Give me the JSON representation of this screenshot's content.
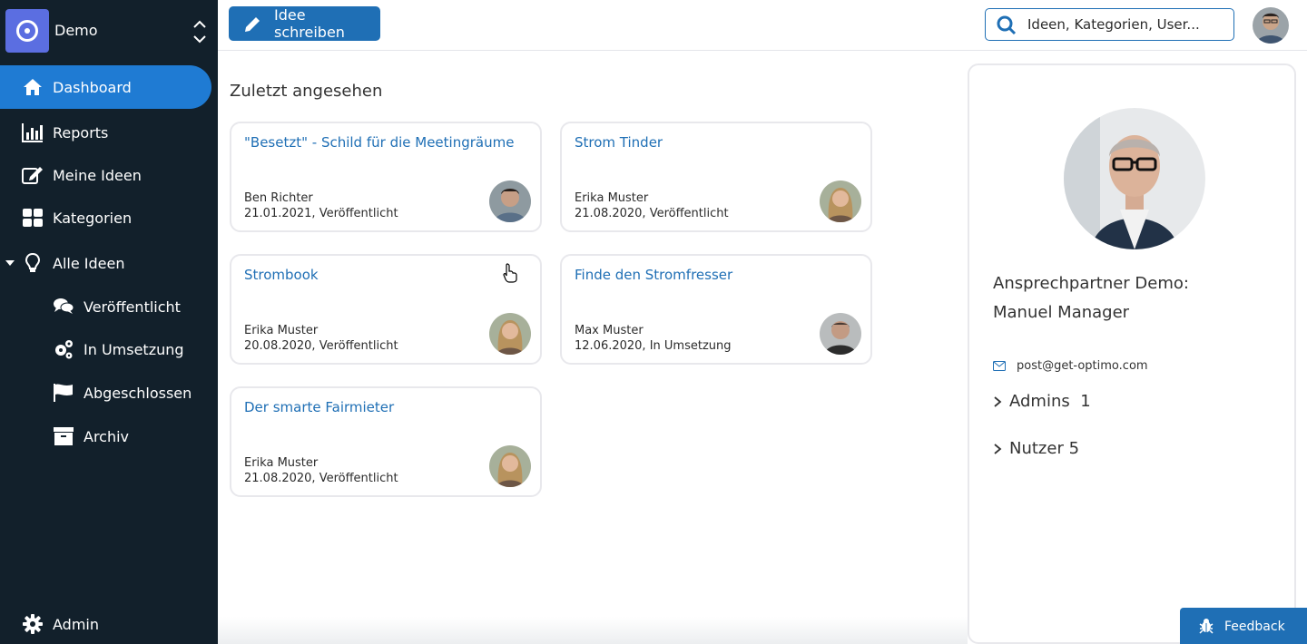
{
  "sidebar": {
    "org_name": "Demo",
    "items": [
      {
        "label": "Dashboard",
        "icon": "home-icon"
      },
      {
        "label": "Reports",
        "icon": "bar-chart-icon"
      },
      {
        "label": "Meine Ideen",
        "icon": "edit-icon"
      },
      {
        "label": "Kategorien",
        "icon": "grid-icon"
      },
      {
        "label": "Alle Ideen",
        "icon": "lightbulb-icon"
      },
      {
        "label": "Veröffentlicht",
        "icon": "comments-icon"
      },
      {
        "label": "In Umsetzung",
        "icon": "gears-icon"
      },
      {
        "label": "Abgeschlossen",
        "icon": "flag-icon"
      },
      {
        "label": "Archiv",
        "icon": "archive-icon"
      }
    ],
    "admin_label": "Admin"
  },
  "topbar": {
    "write_label": "Idee schreiben",
    "search_placeholder": "Ideen, Kategorien, User..."
  },
  "main": {
    "section_title": "Zuletzt angesehen",
    "cards": [
      {
        "title": "\"Besetzt\" - Schild für die Meetingräume",
        "author": "Ben Richter",
        "meta": "21.01.2021, Veröffentlicht"
      },
      {
        "title": "Strom Tinder",
        "author": "Erika Muster",
        "meta": "21.08.2020, Veröffentlicht"
      },
      {
        "title": "Strombook",
        "author": "Erika Muster",
        "meta": "20.08.2020, Veröffentlicht"
      },
      {
        "title": "Finde den Stromfresser",
        "author": "Max Muster",
        "meta": "12.06.2020, In Umsetzung"
      },
      {
        "title": "Der smarte Fairmieter",
        "author": "Erika Muster",
        "meta": "21.08.2020, Veröffentlicht"
      }
    ]
  },
  "panel": {
    "contact_label": "Ansprechpartner Demo:",
    "contact_name": "Manuel Manager",
    "email": "post@get-optimo.com",
    "admins_label": "Admins  1",
    "users_label": "Nutzer 5"
  },
  "feedback_label": "Feedback",
  "colors": {
    "sidebar_bg": "#12202b",
    "accent": "#1f6fb5",
    "active_nav": "#1f7bd3"
  }
}
